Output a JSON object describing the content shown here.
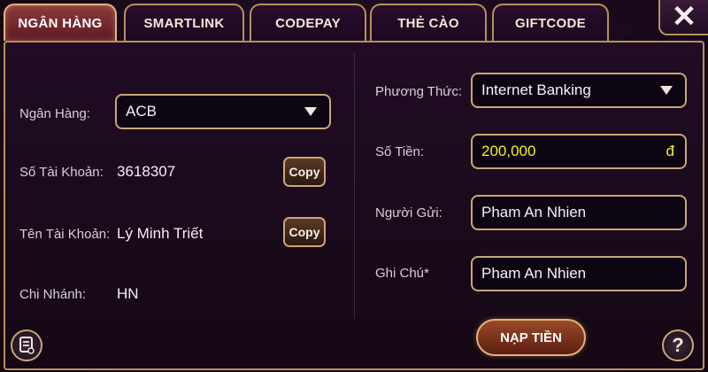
{
  "tabs": [
    {
      "label": "NGÂN HÀNG",
      "active": true
    },
    {
      "label": "SMARTLINK",
      "active": false
    },
    {
      "label": "CODEPAY",
      "active": false
    },
    {
      "label": "THẺ CÀO",
      "active": false
    },
    {
      "label": "GIFTCODE",
      "active": false
    }
  ],
  "close_symbol": "✕",
  "left": {
    "bank": {
      "label": "Ngân Hàng:",
      "value": "ACB"
    },
    "account_number": {
      "label": "Số Tài Khoản:",
      "value": "3618307",
      "copy_label": "Copy"
    },
    "account_name": {
      "label": "Tên Tài Khoản:",
      "value": "Lý Minh Triết",
      "copy_label": "Copy"
    },
    "branch": {
      "label": "Chi Nhánh:",
      "value": "HN"
    }
  },
  "right": {
    "method": {
      "label": "Phương Thức:",
      "value": "Internet Banking"
    },
    "amount": {
      "label": "Số Tiền:",
      "value": "200,000",
      "currency": "đ"
    },
    "sender": {
      "label": "Người Gửi:",
      "value": "Pham An Nhien"
    },
    "note": {
      "label": "Ghi Chú*",
      "value": "Pham An Nhien"
    }
  },
  "submit_label": "NẠP TIỀN",
  "help_symbol": "?",
  "icons": {
    "close": "close-icon",
    "history": "history-icon",
    "help": "help-icon",
    "dropdown": "chevron-down-icon"
  },
  "colors": {
    "accent_border": "#caa57a",
    "amount_text": "#f6ee2a",
    "panel_bg": "#1b0b20"
  }
}
